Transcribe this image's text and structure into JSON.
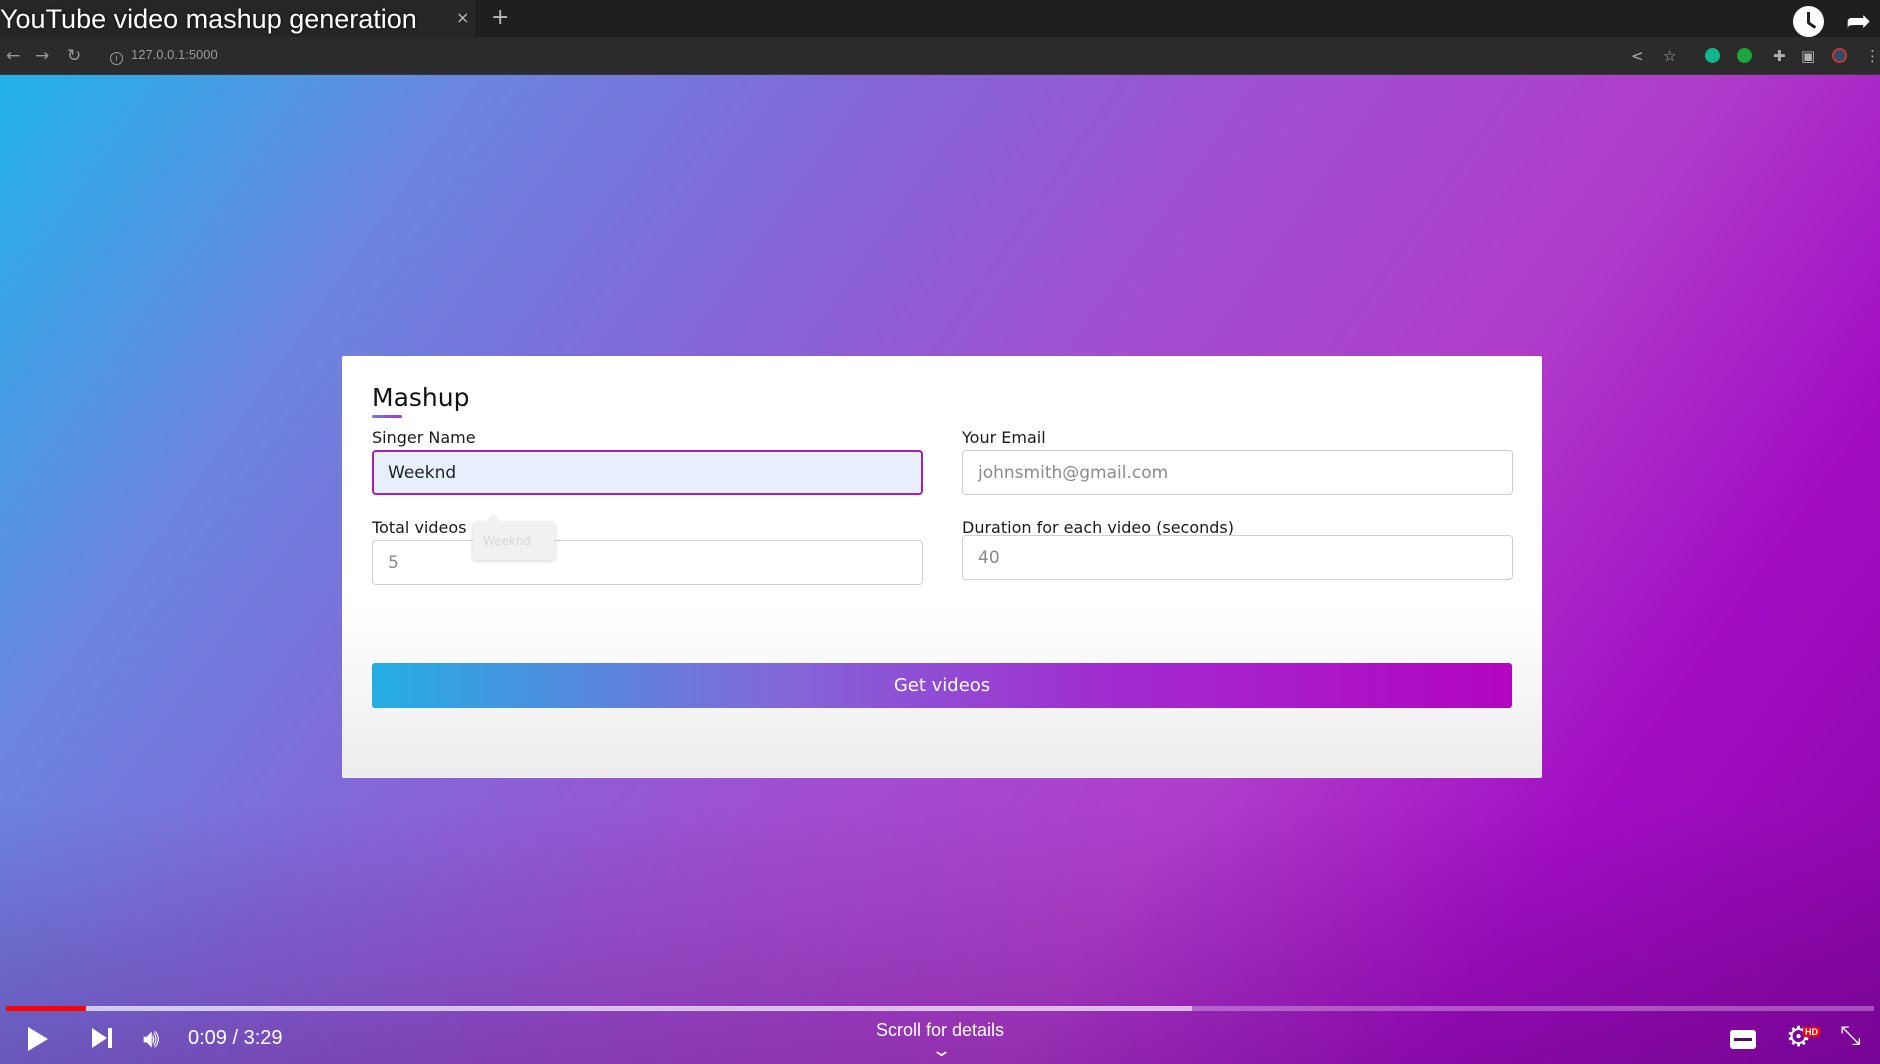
{
  "browser": {
    "url": "127.0.0.1:5000",
    "tab_close": "×",
    "tab_new": "+",
    "back_glyph": "←",
    "forward_glyph": "→",
    "reload_glyph": "↻"
  },
  "video": {
    "title": "YouTube video mashup generation",
    "current_time": "0:09",
    "duration": "3:29",
    "time_display": "0:09 / 3:29",
    "played_fraction": 0.043,
    "buffered_fraction": 0.635,
    "scroll_hint": "Scroll for details",
    "hd_badge": "HD"
  },
  "form": {
    "title": "Mashup",
    "singer_label": "Singer Name",
    "singer_value": "Weeknd",
    "email_label": "Your Email",
    "email_placeholder": "johnsmith@gmail.com",
    "total_label": "Total videos",
    "total_placeholder": "5",
    "duration_label": "Duration for each video (seconds)",
    "duration_placeholder": "40",
    "autofill_suggestion": "Weeknd",
    "submit_label": "Get videos"
  },
  "colors": {
    "gradient_start": "#21b3e8",
    "gradient_mid": "#8169d8",
    "gradient_end": "#b205c0",
    "focus_border": "#a61fb5",
    "progress_red": "#ff0000"
  },
  "icons": [
    "back-arrow-icon",
    "forward-arrow-icon",
    "reload-icon",
    "info-icon",
    "share-icon",
    "star-icon",
    "extension-icon",
    "sidebar-icon",
    "menu-icon",
    "watch-later-icon",
    "play-icon",
    "next-icon",
    "volume-icon",
    "subtitles-icon",
    "settings-gear-icon",
    "exit-fullscreen-icon"
  ]
}
